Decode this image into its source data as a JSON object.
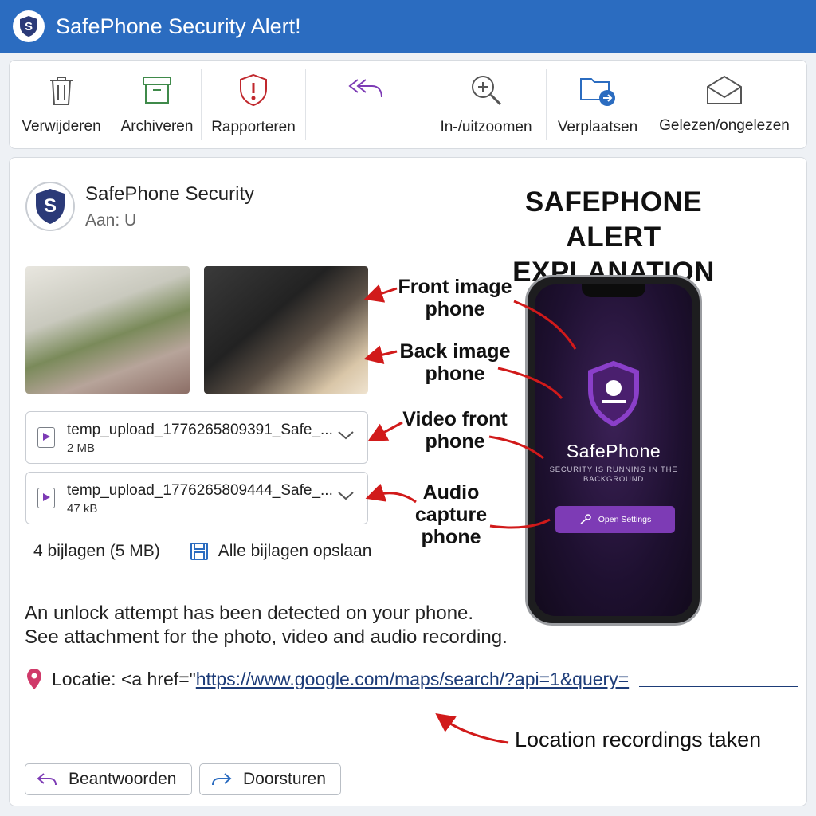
{
  "window": {
    "title": "SafePhone Security Alert!"
  },
  "toolbar": {
    "delete_label": "Verwijderen",
    "archive_label": "Archiveren",
    "report_label": "Rapporteren",
    "zoom_label": "In-/uitzoomen",
    "move_label": "Verplaatsen",
    "read_label": "Gelezen/ongelezen"
  },
  "message": {
    "sender": "SafePhone Security",
    "to": "Aan: U",
    "attachments": [
      {
        "name": "temp_upload_1776265809391_Safe_...",
        "size": "2 MB"
      },
      {
        "name": "temp_upload_1776265809444_Safe_...",
        "size": "47 kB"
      }
    ],
    "attachment_count": "4 bijlagen (5 MB)",
    "save_all": "Alle bijlagen opslaan",
    "body_line1": "An unlock attempt has been detected on your phone.",
    "body_line2": "See attachment for the photo, video and audio recording.",
    "location_prefix": "Locatie: <a href=\"",
    "location_link": "https://www.google.com/maps/search/?api=1&query=",
    "reply_label": "Beantwoorden",
    "forward_label": "Doorsturen"
  },
  "annotation": {
    "heading_line1": "SAFEPHONE ALERT",
    "heading_line2": "EXPLANATION",
    "front_image": [
      "Front image",
      "phone"
    ],
    "back_image": [
      "Back image",
      "phone"
    ],
    "video_front": [
      "Video front",
      "phone"
    ],
    "audio_capture": [
      "Audio",
      "capture",
      "phone"
    ],
    "location_recordings": "Location recordings taken"
  },
  "phone_screen": {
    "app_name": "SafePhone",
    "subtitle": "SECURITY IS RUNNING IN THE BACKGROUND",
    "button_label": "Open Settings"
  },
  "colors": {
    "titlebar": "#2b6cc0",
    "accent_purple": "#7d3bb5",
    "arrow_red": "#d11a1a",
    "link": "#1d3c78"
  }
}
